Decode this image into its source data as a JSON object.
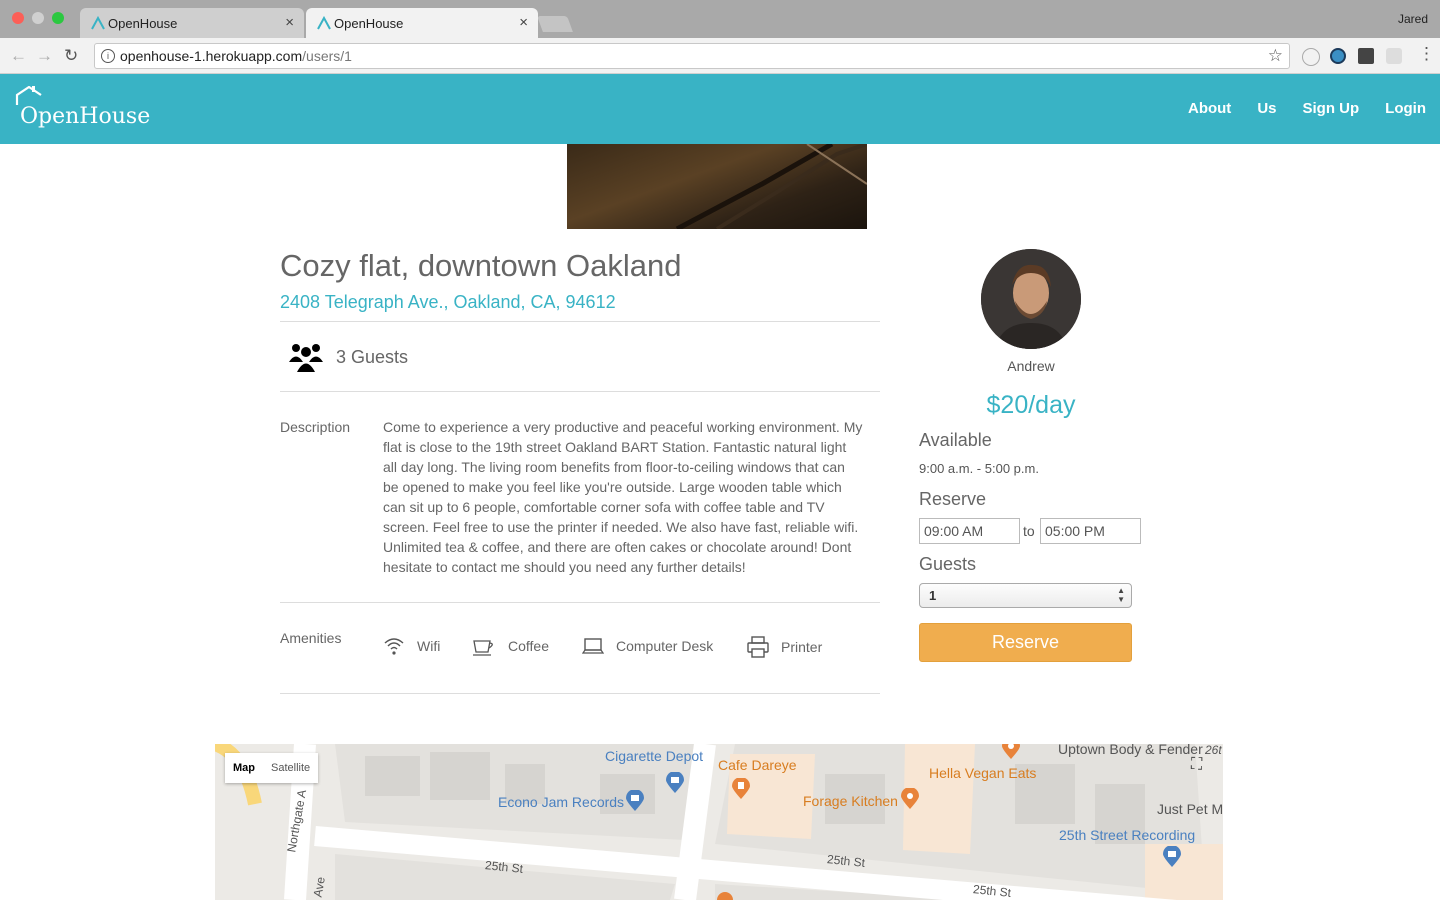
{
  "browser": {
    "tabs": [
      {
        "title": "OpenHouse"
      },
      {
        "title": "OpenHouse"
      }
    ],
    "profile": "Jared",
    "url_host": "openhouse-1.herokuapp.com",
    "url_path": "/users/1"
  },
  "nav": {
    "brand": "OpenHouse",
    "links": [
      "About",
      "Us",
      "Sign Up",
      "Login"
    ]
  },
  "listing": {
    "title": "Cozy flat, downtown Oakland",
    "address": "2408 Telegraph Ave., Oakland, CA, 94612",
    "guests": "3 Guests",
    "description_label": "Description",
    "description": "Come to experience a very productive and peaceful working environment. My flat is close to the 19th street Oakland BART Station. Fantastic natural light all day long. The living room benefits from floor-to-ceiling windows that can be opened to make you feel like you're outside. Large wooden table which can sit up to 6 people, comfortable corner sofa with coffee table and TV screen. Feel free to use the printer if needed. We also have fast, reliable wifi. Unlimited tea & coffee, and there are often cakes or chocolate around! Dont hesitate to contact me should you need any further details!",
    "amenities_label": "Amenities",
    "amenities": [
      {
        "label": "Wifi",
        "icon": "wifi-icon"
      },
      {
        "label": "Coffee",
        "icon": "coffee-cup-icon"
      },
      {
        "label": "Computer Desk",
        "icon": "laptop-icon"
      },
      {
        "label": "Printer",
        "icon": "printer-icon"
      }
    ]
  },
  "sidebar": {
    "host_name": "Andrew",
    "price": "$20/day",
    "available_heading": "Available",
    "available_hours": "9:00 a.m. - 5:00 p.m.",
    "reserve_heading": "Reserve",
    "time_from": "09:00 AM",
    "time_to_word": "to",
    "time_to": "05:00 PM",
    "guests_heading": "Guests",
    "guests_selected": "1",
    "reserve_button": "Reserve"
  },
  "map": {
    "toggle_map": "Map",
    "toggle_satellite": "Satellite",
    "places": {
      "cigarette_depot": "Cigarette Depot",
      "cafe_dareye": "Cafe Dareye",
      "uptown_body": "Uptown Body & Fender",
      "hella_vegan": "Hella Vegan Eats",
      "econo_jam": "Econo Jam Records",
      "forage_kitchen": "Forage Kitchen",
      "just_pet": "Just Pet M",
      "recording": "25th Street Recording"
    },
    "streets": {
      "s25a": "25th St",
      "s25b": "25th St",
      "s25c": "25th St",
      "northgate": "Northgate A",
      "ave": "Ave",
      "s26": "26t"
    }
  },
  "colors": {
    "brand": "#39b3c5",
    "reserve": "#f0ad4e"
  }
}
